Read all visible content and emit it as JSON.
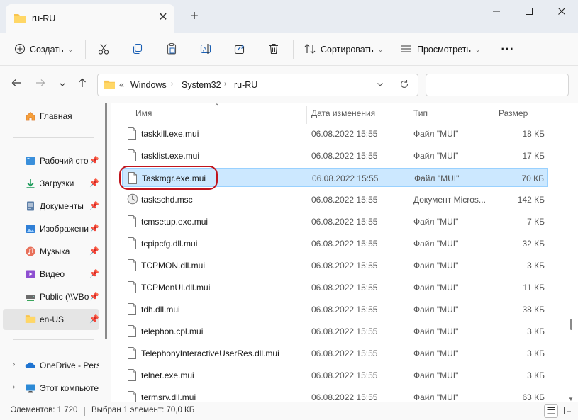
{
  "window": {
    "tab_title": "ru-RU"
  },
  "toolbar": {
    "create_label": "Создать",
    "sort_label": "Сортировать",
    "view_label": "Просмотреть",
    "more_label": "···"
  },
  "address": {
    "overflow": "«",
    "crumbs": [
      "Windows",
      "System32",
      "ru-RU"
    ]
  },
  "sidebar": {
    "home": "Главная",
    "items": [
      {
        "label": "Рабочий сто",
        "icon": "desktop-icon"
      },
      {
        "label": "Загрузки",
        "icon": "download-icon"
      },
      {
        "label": "Документы",
        "icon": "documents-icon"
      },
      {
        "label": "Изображени",
        "icon": "pictures-icon"
      },
      {
        "label": "Музыка",
        "icon": "music-icon"
      },
      {
        "label": "Видео",
        "icon": "video-icon"
      },
      {
        "label": "Public (\\\\VBo",
        "icon": "network-drive-icon"
      },
      {
        "label": "en-US",
        "icon": "folder-icon"
      }
    ],
    "onedrive": "OneDrive - Perso",
    "thispc": "Этот компьютер"
  },
  "columns": {
    "name": "Имя",
    "date": "Дата изменения",
    "type": "Тип",
    "size": "Размер"
  },
  "files": [
    {
      "name": "taskkill.exe.mui",
      "date": "06.08.2022 15:55",
      "type": "Файл \"MUI\"",
      "size": "18 КБ"
    },
    {
      "name": "tasklist.exe.mui",
      "date": "06.08.2022 15:55",
      "type": "Файл \"MUI\"",
      "size": "17 КБ"
    },
    {
      "name": "Taskmgr.exe.mui",
      "date": "06.08.2022 15:55",
      "type": "Файл \"MUI\"",
      "size": "70 КБ"
    },
    {
      "name": "taskschd.msc",
      "date": "06.08.2022 15:55",
      "type": "Документ Micros...",
      "size": "142 КБ"
    },
    {
      "name": "tcmsetup.exe.mui",
      "date": "06.08.2022 15:55",
      "type": "Файл \"MUI\"",
      "size": "7 КБ"
    },
    {
      "name": "tcpipcfg.dll.mui",
      "date": "06.08.2022 15:55",
      "type": "Файл \"MUI\"",
      "size": "32 КБ"
    },
    {
      "name": "TCPMON.dll.mui",
      "date": "06.08.2022 15:55",
      "type": "Файл \"MUI\"",
      "size": "3 КБ"
    },
    {
      "name": "TCPMonUI.dll.mui",
      "date": "06.08.2022 15:55",
      "type": "Файл \"MUI\"",
      "size": "11 КБ"
    },
    {
      "name": "tdh.dll.mui",
      "date": "06.08.2022 15:55",
      "type": "Файл \"MUI\"",
      "size": "38 КБ"
    },
    {
      "name": "telephon.cpl.mui",
      "date": "06.08.2022 15:55",
      "type": "Файл \"MUI\"",
      "size": "3 КБ"
    },
    {
      "name": "TelephonyInteractiveUserRes.dll.mui",
      "date": "06.08.2022 15:55",
      "type": "Файл \"MUI\"",
      "size": "3 КБ"
    },
    {
      "name": "telnet.exe.mui",
      "date": "06.08.2022 15:55",
      "type": "Файл \"MUI\"",
      "size": "3 КБ"
    },
    {
      "name": "termsrv.dll.mui",
      "date": "06.08.2022 15:55",
      "type": "Файл \"MUI\"",
      "size": "63 КБ"
    }
  ],
  "selected_file": "Taskmgr.exe.mui",
  "status": {
    "count": "Элементов: 1 720",
    "selection": "Выбран 1 элемент: 70,0 КБ"
  },
  "colors": {
    "selection_bg": "#cce8ff",
    "selection_border": "#99d1ff",
    "highlight_ring": "#c0141c",
    "folder": "#f8c44f"
  }
}
